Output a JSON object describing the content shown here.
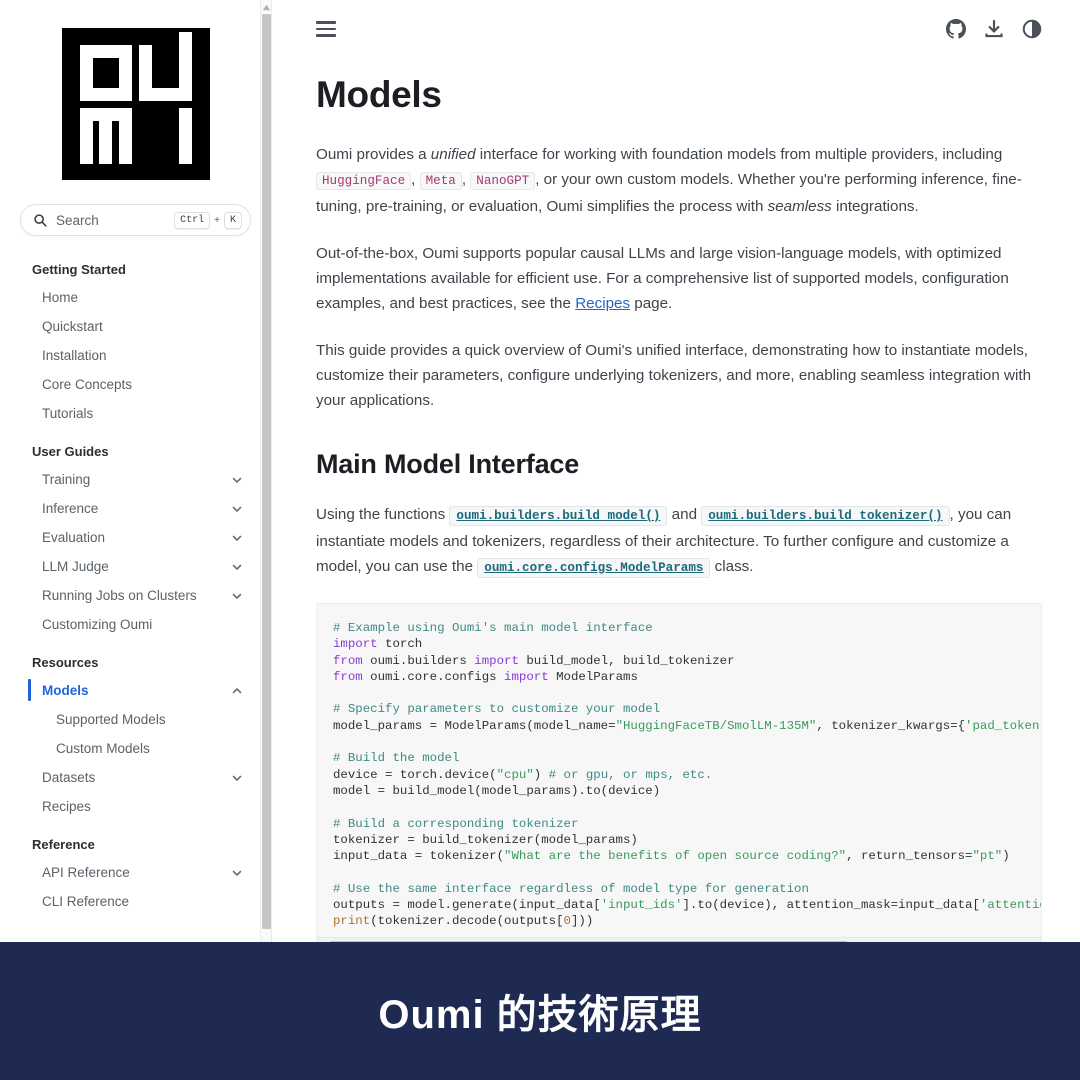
{
  "sidebar": {
    "logo_alt": "oumi-logo",
    "search": {
      "placeholder": "Search",
      "key_modifier": "Ctrl",
      "key_plus": "+",
      "key_letter": "K"
    },
    "sections": [
      {
        "caption": "Getting Started",
        "items": [
          {
            "label": "Home",
            "expandable": false,
            "active": false,
            "sub": false
          },
          {
            "label": "Quickstart",
            "expandable": false,
            "active": false,
            "sub": false
          },
          {
            "label": "Installation",
            "expandable": false,
            "active": false,
            "sub": false
          },
          {
            "label": "Core Concepts",
            "expandable": false,
            "active": false,
            "sub": false
          },
          {
            "label": "Tutorials",
            "expandable": false,
            "active": false,
            "sub": false
          }
        ]
      },
      {
        "caption": "User Guides",
        "items": [
          {
            "label": "Training",
            "expandable": true,
            "active": false,
            "sub": false
          },
          {
            "label": "Inference",
            "expandable": true,
            "active": false,
            "sub": false
          },
          {
            "label": "Evaluation",
            "expandable": true,
            "active": false,
            "sub": false
          },
          {
            "label": "LLM Judge",
            "expandable": true,
            "active": false,
            "sub": false
          },
          {
            "label": "Running Jobs on Clusters",
            "expandable": true,
            "active": false,
            "sub": false
          },
          {
            "label": "Customizing Oumi",
            "expandable": false,
            "active": false,
            "sub": false
          }
        ]
      },
      {
        "caption": "Resources",
        "items": [
          {
            "label": "Models",
            "expandable": true,
            "expanded": true,
            "active": true,
            "sub": false
          },
          {
            "label": "Supported Models",
            "expandable": false,
            "active": false,
            "sub": true
          },
          {
            "label": "Custom Models",
            "expandable": false,
            "active": false,
            "sub": true
          },
          {
            "label": "Datasets",
            "expandable": true,
            "active": false,
            "sub": false
          },
          {
            "label": "Recipes",
            "expandable": false,
            "active": false,
            "sub": false
          }
        ]
      },
      {
        "caption": "Reference",
        "items": [
          {
            "label": "API Reference",
            "expandable": true,
            "active": false,
            "sub": false
          },
          {
            "label": "CLI Reference",
            "expandable": false,
            "active": false,
            "sub": false
          }
        ]
      }
    ]
  },
  "topbar": {
    "menu_icon": "hamburger-icon",
    "actions": [
      "github-icon",
      "download-icon",
      "theme-toggle-icon"
    ]
  },
  "main": {
    "page_title": "Models",
    "paragraph_1": {
      "part_1": "Oumi provides a ",
      "em_1": "unified",
      "part_2": " interface for working with foundation models from multiple providers, including ",
      "chip_1": "HuggingFace",
      "sep_1": ", ",
      "chip_2": "Meta",
      "sep_2": ", ",
      "chip_3": "NanoGPT",
      "part_3": ", or your own custom models. Whether you're performing inference, fine-tuning, pre-training, or evaluation, Oumi simplifies the process with ",
      "em_2": "seamless",
      "part_4": " integrations."
    },
    "paragraph_2": {
      "part_1": "Out-of-the-box, Oumi supports popular causal LLMs and large vision-language models, with optimized implementations available for efficient use. For a comprehensive list of supported models, configuration examples, and best practices, see the ",
      "link": "Recipes",
      "part_2": " page."
    },
    "paragraph_3": "This guide provides a quick overview of Oumi's unified interface, demonstrating how to instantiate models, customize their parameters, configure underlying tokenizers, and more, enabling seamless integration with your applications.",
    "section_title": "Main Model Interface",
    "paragraph_4": {
      "part_1": "Using the functions ",
      "ref_1": "oumi.builders.build_model()",
      "part_2": " and ",
      "ref_2": "oumi.builders.build_tokenizer()",
      "part_3": ", you can instantiate models and tokenizers, regardless of their architecture. To further configure and customize a model, you can use the ",
      "ref_3": "oumi.core.configs.ModelParams",
      "part_4": " class."
    },
    "code": {
      "language": "python",
      "lines": [
        {
          "tokens": [
            {
              "t": "# Example using Oumi's main model interface",
              "c": "cm"
            }
          ]
        },
        {
          "tokens": [
            {
              "t": "import",
              "c": "kw"
            },
            {
              "t": " torch",
              "c": "nm"
            }
          ]
        },
        {
          "tokens": [
            {
              "t": "from",
              "c": "kw"
            },
            {
              "t": " oumi.builders ",
              "c": "nm"
            },
            {
              "t": "import",
              "c": "kw"
            },
            {
              "t": " build_model, build_tokenizer",
              "c": "nm"
            }
          ]
        },
        {
          "tokens": [
            {
              "t": "from",
              "c": "kw"
            },
            {
              "t": " oumi.core.configs ",
              "c": "nm"
            },
            {
              "t": "import",
              "c": "kw"
            },
            {
              "t": " ModelParams",
              "c": "nm"
            }
          ]
        },
        {
          "tokens": [
            {
              "t": "",
              "c": "nm"
            }
          ]
        },
        {
          "tokens": [
            {
              "t": "# Specify parameters to customize your model",
              "c": "cm"
            }
          ]
        },
        {
          "tokens": [
            {
              "t": "model_params = ModelParams(model_name=",
              "c": "nm"
            },
            {
              "t": "\"HuggingFaceTB/SmolLM-135M\"",
              "c": "st"
            },
            {
              "t": ", tokenizer_kwargs={",
              "c": "nm"
            },
            {
              "t": "'pad_token'",
              "c": "st"
            },
            {
              "t": ": ",
              "c": "nm"
            },
            {
              "t": "'<",
              "c": "st"
            }
          ]
        },
        {
          "tokens": [
            {
              "t": "",
              "c": "nm"
            }
          ]
        },
        {
          "tokens": [
            {
              "t": "# Build the model",
              "c": "cm"
            }
          ]
        },
        {
          "tokens": [
            {
              "t": "device = torch.device(",
              "c": "nm"
            },
            {
              "t": "\"cpu\"",
              "c": "st"
            },
            {
              "t": ") ",
              "c": "nm"
            },
            {
              "t": "# or gpu, or mps, etc.",
              "c": "cm"
            }
          ]
        },
        {
          "tokens": [
            {
              "t": "model = build_model(model_params).to(device)",
              "c": "nm"
            }
          ]
        },
        {
          "tokens": [
            {
              "t": "",
              "c": "nm"
            }
          ]
        },
        {
          "tokens": [
            {
              "t": "# Build a corresponding tokenizer",
              "c": "cm"
            }
          ]
        },
        {
          "tokens": [
            {
              "t": "tokenizer = build_tokenizer(model_params)",
              "c": "nm"
            }
          ]
        },
        {
          "tokens": [
            {
              "t": "input_data = tokenizer(",
              "c": "nm"
            },
            {
              "t": "\"What are the benefits of open source coding?\"",
              "c": "st"
            },
            {
              "t": ", return_tensors=",
              "c": "nm"
            },
            {
              "t": "\"pt\"",
              "c": "st"
            },
            {
              "t": ")",
              "c": "nm"
            }
          ]
        },
        {
          "tokens": [
            {
              "t": "",
              "c": "nm"
            }
          ]
        },
        {
          "tokens": [
            {
              "t": "# Use the same interface regardless of model type for generation",
              "c": "cm"
            }
          ]
        },
        {
          "tokens": [
            {
              "t": "outputs = model.generate(input_data[",
              "c": "nm"
            },
            {
              "t": "'input_ids'",
              "c": "st"
            },
            {
              "t": "].to(device), attention_mask=input_data[",
              "c": "nm"
            },
            {
              "t": "'attention_mas",
              "c": "st"
            }
          ]
        },
        {
          "tokens": [
            {
              "t": "print",
              "c": "nb"
            },
            {
              "t": "(tokenizer.decode(outputs[",
              "c": "nm"
            },
            {
              "t": "0",
              "c": "nb"
            },
            {
              "t": "]))",
              "c": "nm"
            }
          ]
        }
      ]
    }
  },
  "banner": {
    "text": "Oumi 的技術原理",
    "background_color": "#1e2a52",
    "text_color": "#ffffff"
  }
}
